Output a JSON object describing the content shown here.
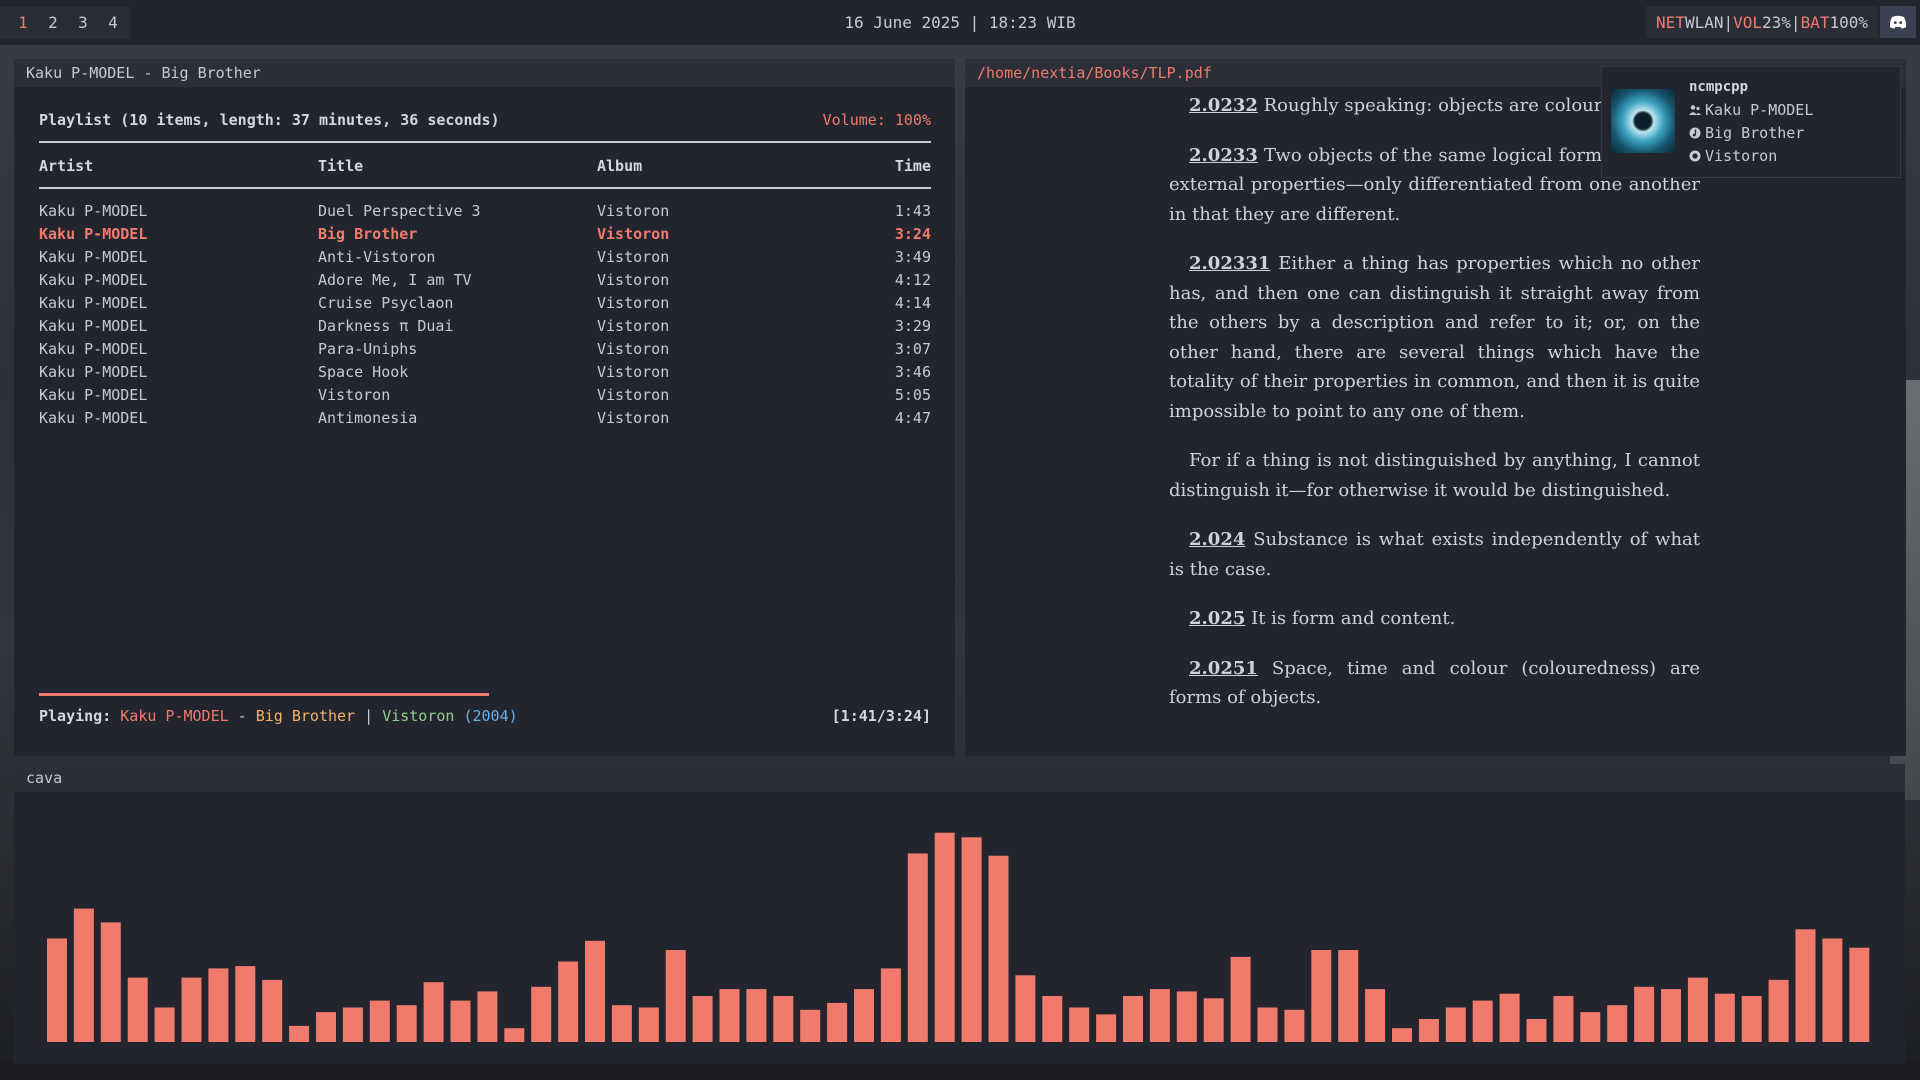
{
  "topbar": {
    "workspaces": [
      "1",
      "2",
      "3",
      "4"
    ],
    "active_workspace": "1",
    "clock": "16 June 2025 | 18:23 WIB",
    "net_label": "NET",
    "net_value": "WLAN",
    "vol_label": "VOL",
    "vol_value": "23%",
    "bat_label": "BAT",
    "bat_value": "100%",
    "separator": "|",
    "tray_icon": "discord-icon"
  },
  "ncmpcpp": {
    "window_title": "Kaku P-MODEL - Big Brother",
    "playlist_header": "Playlist (10 items, length: 37 minutes, 36 seconds)",
    "volume": "Volume: 100%",
    "columns": {
      "artist": "Artist",
      "title": "Title",
      "album": "Album",
      "time": "Time"
    },
    "rows": [
      {
        "artist": "Kaku P-MODEL",
        "title": "Duel Perspective 3",
        "album": "Vistoron",
        "time": "1:43"
      },
      {
        "artist": "Kaku P-MODEL",
        "title": "Big Brother",
        "album": "Vistoron",
        "time": "3:24",
        "current": true
      },
      {
        "artist": "Kaku P-MODEL",
        "title": "Anti-Vistoron",
        "album": "Vistoron",
        "time": "3:49"
      },
      {
        "artist": "Kaku P-MODEL",
        "title": "Adore Me, I am TV",
        "album": "Vistoron",
        "time": "4:12"
      },
      {
        "artist": "Kaku P-MODEL",
        "title": "Cruise Psyclaon",
        "album": "Vistoron",
        "time": "4:14"
      },
      {
        "artist": "Kaku P-MODEL",
        "title": "Darkness π Duai",
        "album": "Vistoron",
        "time": "3:29"
      },
      {
        "artist": "Kaku P-MODEL",
        "title": "Para-Uniphs",
        "album": "Vistoron",
        "time": "3:07"
      },
      {
        "artist": "Kaku P-MODEL",
        "title": "Space Hook",
        "album": "Vistoron",
        "time": "3:46"
      },
      {
        "artist": "Kaku P-MODEL",
        "title": "Vistoron",
        "album": "Vistoron",
        "time": "5:05"
      },
      {
        "artist": "Kaku P-MODEL",
        "title": "Antimonesia",
        "album": "Vistoron",
        "time": "4:47"
      }
    ],
    "progress_fraction": 0.505,
    "now_playing": {
      "label": "Playing:",
      "artist": "Kaku P-MODEL",
      "dash": " - ",
      "title": "Big Brother",
      "pipe": " | ",
      "album": "Vistoron",
      "year": "(2004)",
      "elapsed": "[1:41/3:24]"
    }
  },
  "pdf": {
    "path": "/home/nextia/Books/TLP.pdf",
    "paragraphs": [
      {
        "num": "2.0232",
        "text": " Roughly speaking: objects are colourless."
      },
      {
        "num": "2.0233",
        "text": " Two objects of the same logical form are—their external properties—only differentiated from one another in that they are different."
      },
      {
        "num": "2.02331",
        "text": " Either a thing has properties which no other has, and then one can distinguish it straight away from the others by a description and refer to it; or, on the other hand, there are several things which have the totality of their properties in common, and then it is quite impossible to point to any one of them."
      },
      {
        "num": "",
        "text": "For if a thing is not distinguished by anything, I cannot distinguish it—for otherwise it would be distinguished."
      },
      {
        "num": "2.024",
        "text": " Substance is what exists independently of what is the case."
      },
      {
        "num": "2.025",
        "text": " It is form and content."
      },
      {
        "num": "2.0251",
        "text": " Space, time and colour (colouredness) are forms of objects."
      }
    ]
  },
  "notification": {
    "app": "ncmpcpp",
    "artist": "Kaku P-MODEL",
    "title": "Big Brother",
    "album": "Vistoron",
    "icons": [
      "artist-icon",
      "track-icon",
      "album-icon",
      "album-art"
    ]
  },
  "cava": {
    "window_title": "cava",
    "bar_color": "#f07b6d",
    "levels": [
      0.45,
      0.58,
      0.52,
      0.28,
      0.15,
      0.28,
      0.32,
      0.33,
      0.27,
      0.07,
      0.13,
      0.15,
      0.18,
      0.16,
      0.26,
      0.18,
      0.22,
      0.06,
      0.24,
      0.35,
      0.44,
      0.16,
      0.15,
      0.4,
      0.2,
      0.23,
      0.23,
      0.2,
      0.14,
      0.17,
      0.23,
      0.32,
      0.82,
      0.91,
      0.89,
      0.81,
      0.29,
      0.2,
      0.15,
      0.12,
      0.2,
      0.23,
      0.22,
      0.19,
      0.37,
      0.15,
      0.14,
      0.4,
      0.4,
      0.23,
      0.06,
      0.1,
      0.15,
      0.18,
      0.21,
      0.1,
      0.2,
      0.13,
      0.16,
      0.24,
      0.23,
      0.28,
      0.21,
      0.2,
      0.27,
      0.49,
      0.45,
      0.41
    ]
  }
}
